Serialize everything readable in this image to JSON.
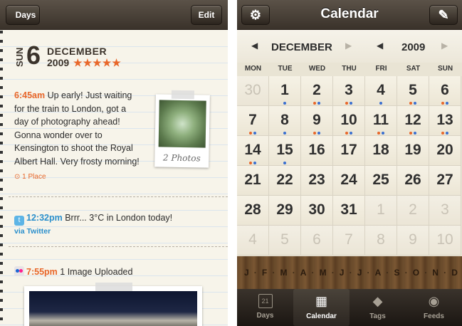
{
  "left": {
    "nav": {
      "back_label": "Days",
      "edit_label": "Edit"
    },
    "date": {
      "weekday": "SUN",
      "day": "6",
      "month": "DECEMBER",
      "year": "2009",
      "stars": "★★★★★"
    },
    "entries": [
      {
        "time": "6:45am",
        "lines": [
          "Up early! Just waiting",
          "for the train to London, got a",
          "day of photography ahead!",
          "Gonna wonder over to",
          "Kensington to shoot the Royal",
          "Albert Hall. Very frosty morning!"
        ],
        "place": "⊙ 1 Place"
      },
      {
        "time": "12:32pm",
        "text": "Brrr... 3°C in London today!",
        "via": "via Twitter"
      },
      {
        "time": "7:55pm",
        "text": "1 Image Uploaded"
      }
    ],
    "polaroid_caption": "2 Photos"
  },
  "right": {
    "nav": {
      "title": "Calendar"
    },
    "month": "DECEMBER",
    "year": "2009",
    "weekdays": [
      "MON",
      "TUE",
      "WED",
      "THU",
      "FRI",
      "SAT",
      "SUN"
    ],
    "weeks": [
      [
        "30",
        "1",
        "2",
        "3",
        "4",
        "5",
        "6"
      ],
      [
        "7",
        "8",
        "9",
        "10",
        "11",
        "12",
        "13"
      ],
      [
        "14",
        "15",
        "16",
        "17",
        "18",
        "19",
        "20"
      ],
      [
        "21",
        "22",
        "23",
        "24",
        "25",
        "26",
        "27"
      ],
      [
        "28",
        "29",
        "30",
        "31",
        "1",
        "2",
        "3"
      ],
      [
        "4",
        "5",
        "6",
        "7",
        "8",
        "9",
        "10"
      ]
    ],
    "month_strip": [
      "J",
      "F",
      "M",
      "A",
      "M",
      "J",
      "J",
      "A",
      "S",
      "O",
      "N",
      "D"
    ],
    "tabs": [
      {
        "label": "Days",
        "icon": "calendar-day-icon",
        "badge": "21"
      },
      {
        "label": "Calendar",
        "icon": "calendar-grid-icon"
      },
      {
        "label": "Tags",
        "icon": "tag-icon"
      },
      {
        "label": "Feeds",
        "icon": "broadcast-icon"
      }
    ]
  }
}
